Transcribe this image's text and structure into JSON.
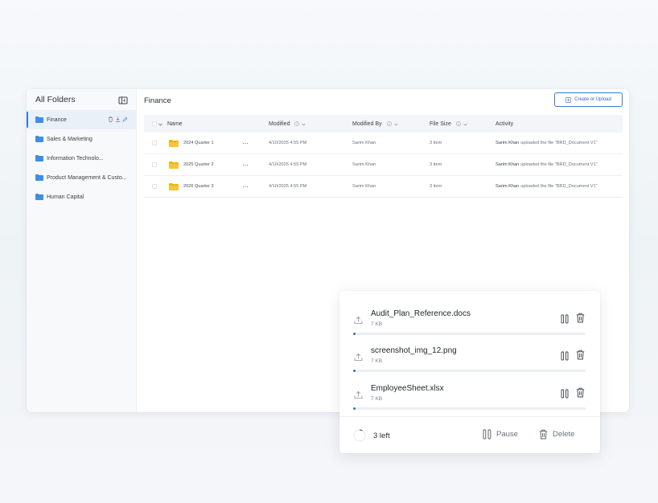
{
  "sidebar": {
    "title": "All Folders",
    "items": [
      {
        "label": "Finance",
        "active": true
      },
      {
        "label": "Sales & Marketing",
        "active": false
      },
      {
        "label": "Information Technolo...",
        "active": false
      },
      {
        "label": "Product Management & Custo...",
        "active": false
      },
      {
        "label": "Human Capital",
        "active": false
      }
    ]
  },
  "main": {
    "title": "Finance",
    "create_label": "Create or Upload"
  },
  "table": {
    "headers": {
      "name": "Name",
      "modified": "Modified",
      "modified_by": "Modified By",
      "file_size": "File Size",
      "activity": "Activity"
    },
    "rows": [
      {
        "name": "2024 Quarter 1",
        "modified": "4/10/2025 4:55 PM",
        "modified_by": "Sarim Khan",
        "size": "3 item",
        "activity_user": "Sarim Khan",
        "activity_text": "uploaded the file \"BRD_Document V1\""
      },
      {
        "name": "2025 Quarter 2",
        "modified": "4/10/2025 4:55 PM",
        "modified_by": "Sarim Khan",
        "size": "3 item",
        "activity_user": "Sarim Khan",
        "activity_text": "uploaded the file \"BRD_Document V1\""
      },
      {
        "name": "2026 Quarter 3",
        "modified": "4/10/2025 4:55 PM",
        "modified_by": "Sarim Khan",
        "size": "3 item",
        "activity_user": "Sarim Khan",
        "activity_text": "uploaded the file \"BRD_Document V1\""
      }
    ]
  },
  "uploads": {
    "items": [
      {
        "name": "Audit_Plan_Reference.docs",
        "size": "7 KB",
        "progress": 0.01
      },
      {
        "name": "screenshot_img_12.png",
        "size": "7 KB",
        "progress": 0.01
      },
      {
        "name": "EmployeeSheet.xlsx",
        "size": "7 KB",
        "progress": 0.01
      }
    ],
    "remaining": "3 left",
    "pause_label": "Pause",
    "delete_label": "Delete"
  },
  "colors": {
    "accent": "#2f6cc4",
    "folder_sidebar": "#3d8fe6",
    "folder_row": "#f4b400"
  }
}
